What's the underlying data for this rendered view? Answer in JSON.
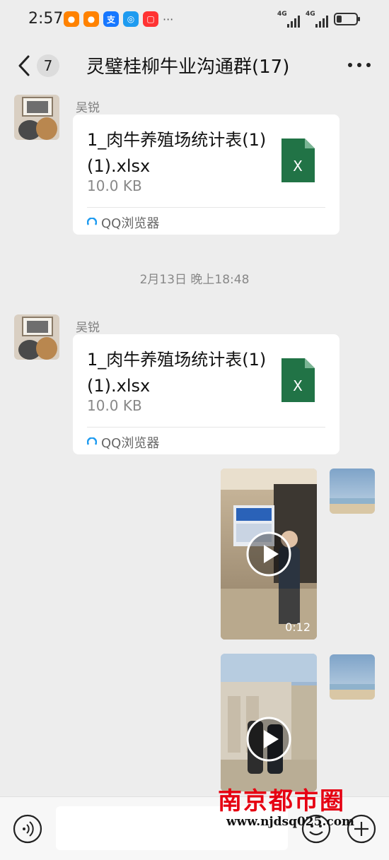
{
  "status_bar": {
    "time": "2:57",
    "network_1": "4G",
    "network_2": "4G",
    "notification_icons": [
      "weibo-icon",
      "weibo-icon",
      "alipay-icon",
      "browser-icon",
      "video-app-icon",
      "more-notifications-icon"
    ]
  },
  "header": {
    "unread_count": "7",
    "title": "灵璧桂柳牛业沟通群(17)"
  },
  "messages": [
    {
      "type": "file",
      "sender": "吴锐",
      "file_name": "1_肉牛养殖场统计表(1)(1).xlsx",
      "file_size": "10.0 KB",
      "source_app": "QQ浏览器"
    },
    {
      "type": "timestamp",
      "text": "2月13日 晚上18:48"
    },
    {
      "type": "file",
      "sender": "吴锐",
      "file_name": "1_肉牛养殖场统计表(1)(1).xlsx",
      "file_size": "10.0 KB",
      "source_app": "QQ浏览器"
    },
    {
      "type": "video",
      "from_self": true,
      "duration": "0:12"
    },
    {
      "type": "video",
      "from_self": true,
      "duration": ""
    }
  ],
  "input_bar": {
    "placeholder": ""
  },
  "watermark": {
    "text_cn": "南京都市圈",
    "url": "www.njdsq025.com"
  },
  "colors": {
    "background": "#ededed",
    "excel_green": "#217346",
    "qq_blue": "#1e9bf0",
    "watermark_red": "#e60012"
  }
}
